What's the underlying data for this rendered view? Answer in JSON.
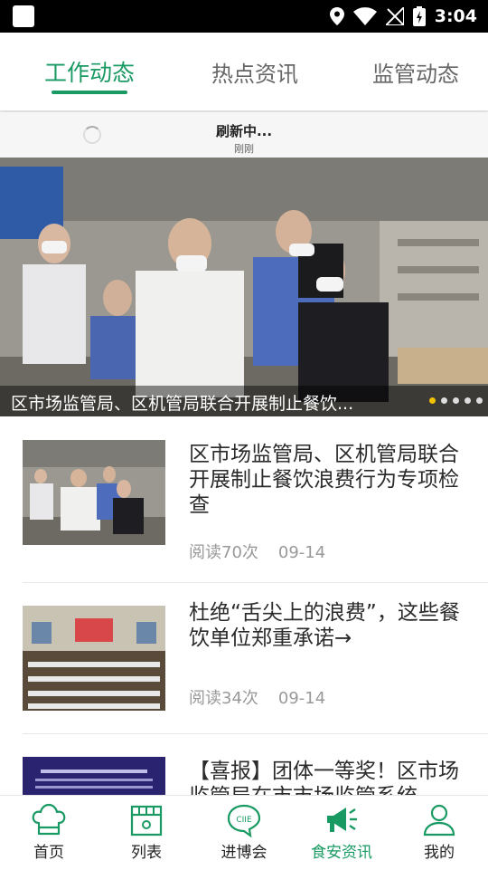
{
  "status_bar": {
    "time": "3:04"
  },
  "tabs": [
    {
      "label": "工作动态",
      "active": true
    },
    {
      "label": "热点资讯",
      "active": false
    },
    {
      "label": "监管动态",
      "active": false
    }
  ],
  "refresh": {
    "status": "刷新中...",
    "time": "刚刚"
  },
  "banner": {
    "caption": "区市场监管局、区机管局联合开展制止餐饮...",
    "dots_total": 5,
    "dot_active": 1
  },
  "articles": [
    {
      "title": "区市场监管局、区机管局联合开展制止餐饮浪费行为专项检查",
      "reads": "阅读70次",
      "date": "09-14"
    },
    {
      "title": "杜绝“舌尖上的浪费”，这些餐饮单位郑重承诺→",
      "reads": "阅读34次",
      "date": "09-14"
    },
    {
      "title": "【喜报】团体一等奖！区市场监管局在市市场监管系统",
      "reads": "",
      "date": ""
    }
  ],
  "bottom_nav": [
    {
      "label": "首页",
      "icon": "chef-hat-icon",
      "active": false
    },
    {
      "label": "列表",
      "icon": "storefront-icon",
      "active": false
    },
    {
      "label": "进博会",
      "icon": "ciie-icon",
      "active": false
    },
    {
      "label": "食安资讯",
      "icon": "megaphone-icon",
      "active": true
    },
    {
      "label": "我的",
      "icon": "person-icon",
      "active": false
    }
  ],
  "colors": {
    "accent": "#1a9a63",
    "highlight_dot": "#f2c100"
  }
}
